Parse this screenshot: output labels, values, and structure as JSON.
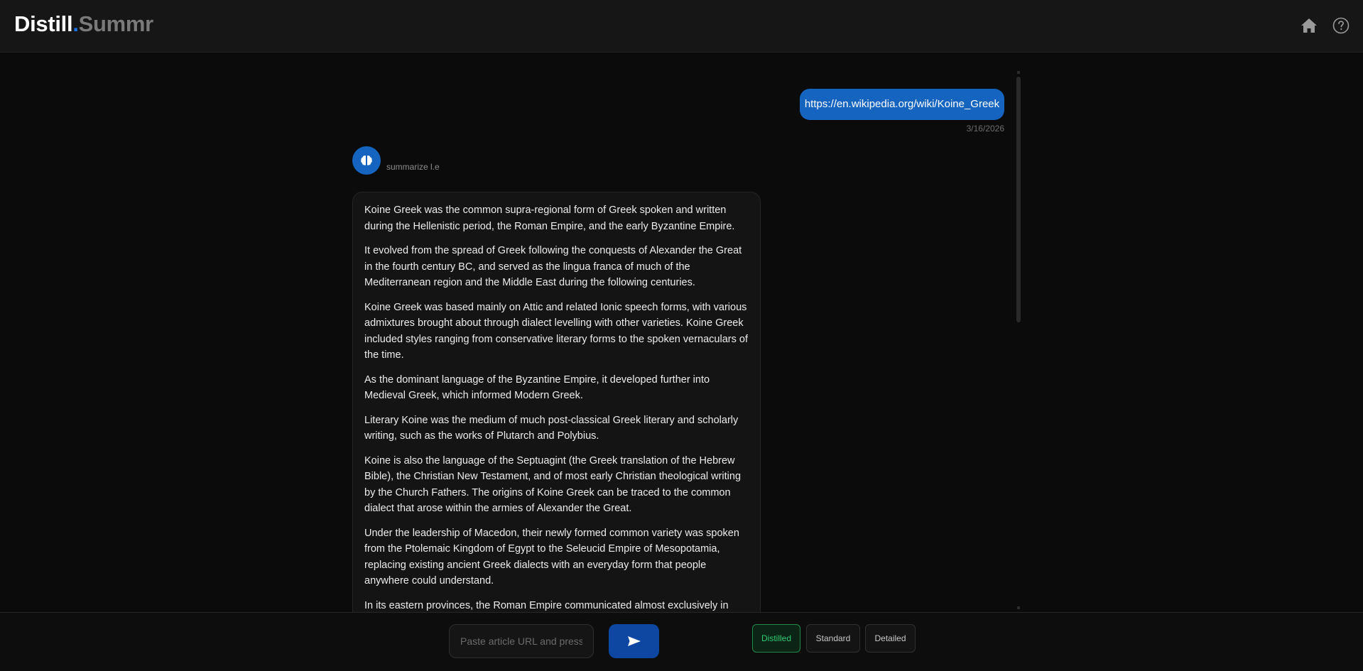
{
  "app": {
    "logo_part1": "Distill",
    "logo_dot": ".",
    "logo_part2": "Summr"
  },
  "colors": {
    "brand_blue": "#1565c0",
    "send_button": "#0d47a1",
    "active_mode_green": "#2ecc71",
    "background": "#0b0b0b"
  },
  "header": {
    "icons": [
      "home-icon",
      "help-circle-icon"
    ]
  },
  "chat": {
    "user_message": {
      "text": "https://en.wikipedia.org/wiki/Koine_Greek",
      "date": "3/16/2026"
    },
    "bot": {
      "avatar_icon": "brain-icon",
      "name": "summarize l.e",
      "paragraphs": [
        "Koine Greek was the common supra-regional form of Greek spoken and written during the Hellenistic period, the Roman Empire, and the early Byzantine Empire.",
        "It evolved from the spread of Greek following the conquests of Alexander the Great in the fourth century BC, and served as the lingua franca of much of the Mediterranean region and the Middle East during the following centuries.",
        "Koine Greek was based mainly on Attic and related Ionic speech forms, with various admixtures brought about through dialect levelling with other varieties. Koine Greek included styles ranging from conservative literary forms to the spoken vernaculars of the time.",
        "As the dominant language of the Byzantine Empire, it developed further into Medieval Greek, which informed Modern Greek.",
        "Literary Koine was the medium of much post-classical Greek literary and scholarly writing, such as the works of Plutarch and Polybius.",
        "Koine is also the language of the Septuagint (the Greek translation of the Hebrew Bible), the Christian New Testament, and of most early Christian theological writing by the Church Fathers. The origins of Koine Greek can be traced to the common dialect that arose within the armies of Alexander the Great.",
        "Under the leadership of Macedon, their newly formed common variety was spoken from the Ptolemaic Kingdom of Egypt to the Seleucid Empire of Mesopotamia, replacing existing ancient Greek dialects with an everyday form that people anywhere could understand.",
        "In its eastern provinces, the Roman Empire communicated almost exclusively in Greek."
      ]
    }
  },
  "input": {
    "placeholder": "Paste article URL and press Enter",
    "value": "",
    "send_icon": "send-icon"
  },
  "modes": {
    "selected": "Distilled",
    "options": [
      "Distilled",
      "Standard",
      "Detailed"
    ]
  }
}
